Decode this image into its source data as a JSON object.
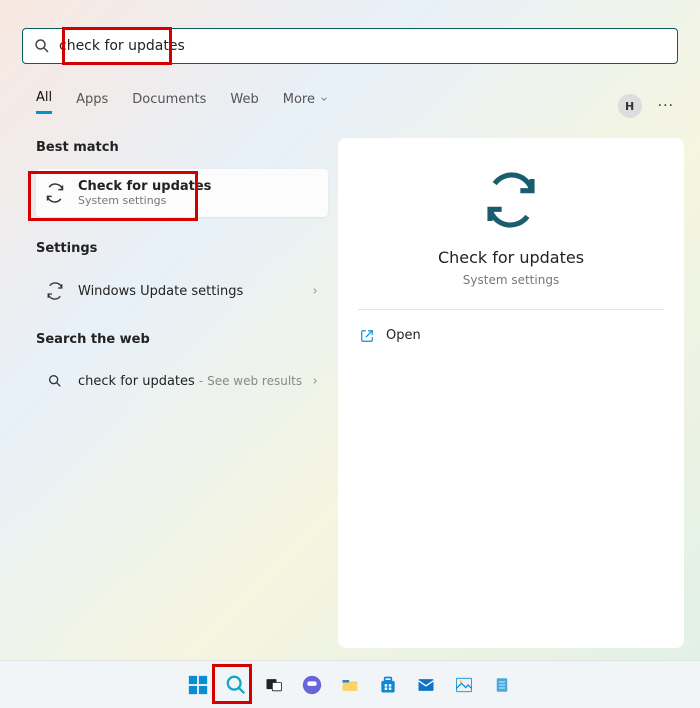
{
  "search": {
    "query": "check for updates"
  },
  "tabs": {
    "all": "All",
    "apps": "Apps",
    "documents": "Documents",
    "web": "Web",
    "more": "More"
  },
  "user": {
    "initial": "H"
  },
  "left": {
    "best_match": "Best match",
    "best_item": {
      "title": "Check for updates",
      "subtitle": "System settings"
    },
    "settings_header": "Settings",
    "settings_item": "Windows Update settings",
    "search_web_header": "Search the web",
    "web_item": "check for updates",
    "web_item_hint": "See web results"
  },
  "preview": {
    "title": "Check for updates",
    "subtitle": "System settings",
    "open": "Open"
  }
}
